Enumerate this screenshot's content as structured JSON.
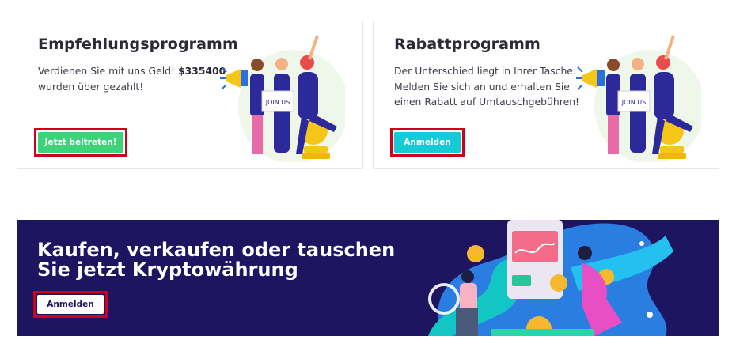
{
  "referral": {
    "title": "Empfehlungsprogramm",
    "text_before": "Verdienen Sie mit uns Geld! ",
    "amount": "$335400",
    "text_after": " wurden über gezahlt!",
    "button_label": "Jetzt beitreten!",
    "sign_text": "JOIN US"
  },
  "discount": {
    "title": "Rabattprogramm",
    "text": "Der Unterschied liegt in Ihrer Tasche. Melden Sie sich an und erhalten Sie einen Rabatt auf Umtauschgebühren!",
    "button_label": "Anmelden",
    "sign_text": "JOIN US"
  },
  "banner": {
    "title": "Kaufen, verkaufen oder tauschen Sie jetzt Kryptowährung",
    "button_label": "Anmelden"
  },
  "colors": {
    "accent_green": "#3ed37a",
    "accent_teal": "#16cbd6",
    "banner_bg": "#1d155f",
    "highlight": "#d0021b"
  }
}
